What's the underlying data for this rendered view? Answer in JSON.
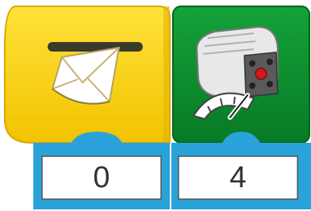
{
  "blocks": [
    {
      "name": "message-block",
      "icon": "envelope-message-icon",
      "color": "#f7cd00",
      "dark_color": "#e0b300",
      "param_color": "#29a3da",
      "input_value": "0"
    },
    {
      "name": "motor-speed-block",
      "icon": "motor-speed-icon",
      "color": "#0b8a2c",
      "dark_color": "#076b20",
      "param_color": "#29a3da",
      "input_value": "4"
    }
  ]
}
